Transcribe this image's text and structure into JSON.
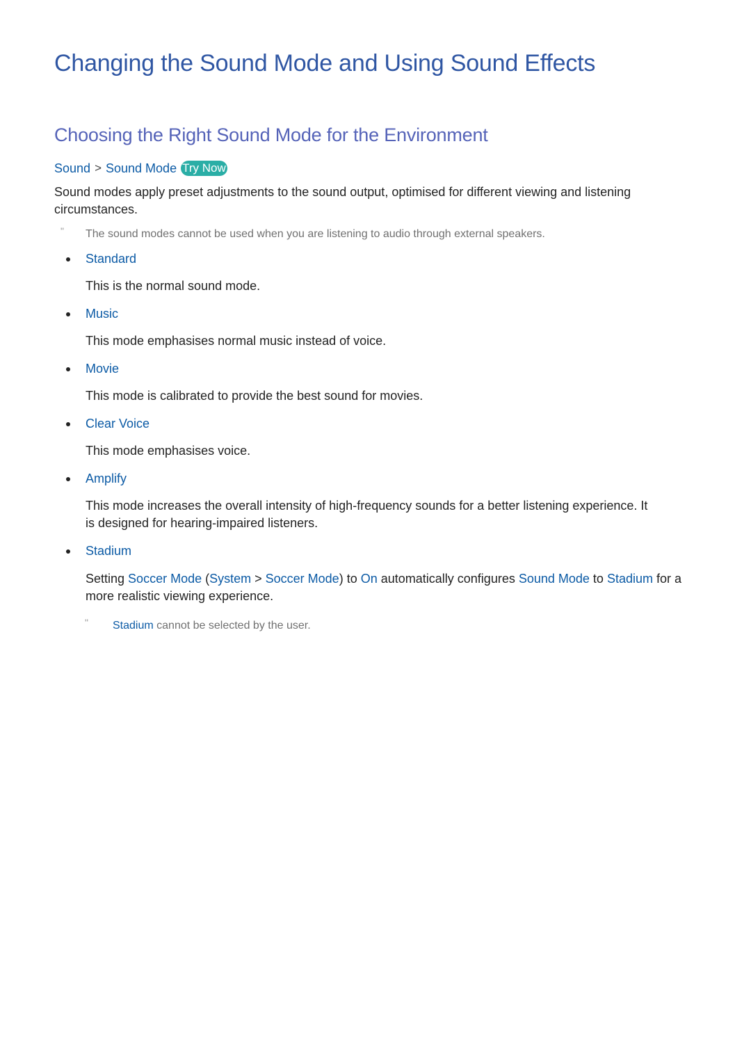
{
  "title": "Changing the Sound Mode and Using Sound Effects",
  "section_title": "Choosing the Right Sound Mode for the Environment",
  "breadcrumb": {
    "items": [
      "Sound",
      "Sound Mode"
    ],
    "separator": ">",
    "try_now": "Try Now"
  },
  "intro": "Sound modes apply preset adjustments to the sound output, optimised for different viewing and listening circumstances.",
  "intro_note": {
    "marker": "\"",
    "text": "The sound modes cannot be used when you are listening to audio through external speakers."
  },
  "modes": [
    {
      "name": "Standard",
      "description": "This is the normal sound mode."
    },
    {
      "name": "Music",
      "description": "This mode emphasises normal music instead of voice."
    },
    {
      "name": "Movie",
      "description": "This mode is calibrated to provide the best sound for movies."
    },
    {
      "name": "Clear Voice",
      "description": "This mode emphasises voice."
    },
    {
      "name": "Amplify",
      "description": "This mode increases the overall intensity of high-frequency sounds for a better listening experience. It is designed for hearing-impaired listeners."
    },
    {
      "name": "Stadium",
      "description_parts": {
        "t1": "Setting ",
        "l1": "Soccer Mode",
        "t2": " (",
        "l2": "System",
        "sep": " > ",
        "l3": "Soccer Mode",
        "t3": ") to ",
        "l4": "On",
        "t4": " automatically configures ",
        "l5": "Sound Mode",
        "t5": " to ",
        "l6": "Stadium",
        "t6": " for a more realistic viewing experience."
      }
    }
  ],
  "stadium_note": {
    "marker": "\"",
    "link": "Stadium",
    "text": " cannot be selected by the user."
  },
  "colors": {
    "title": "#2f56a3",
    "section_title": "#5563b8",
    "link": "#0b5aa5",
    "try_now_bg": "#2aaea6",
    "body_text": "#222222",
    "note_text": "#707070"
  }
}
